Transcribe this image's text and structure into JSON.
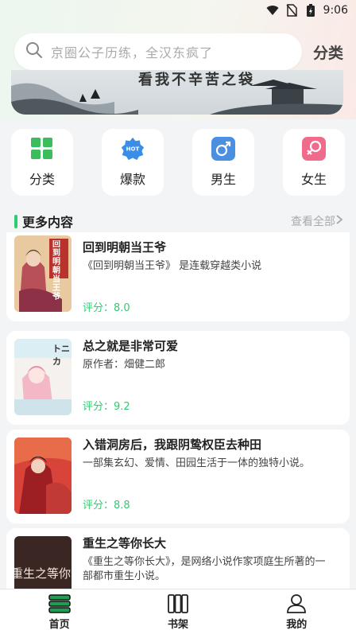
{
  "status": {
    "time": "9:06"
  },
  "search": {
    "placeholder": "京圈公子历练，全汉东疯了",
    "category_label": "分类"
  },
  "banner": {
    "title": "看我不辛苦之袋"
  },
  "categories": [
    {
      "label": "分类",
      "icon": "grid-icon"
    },
    {
      "label": "爆款",
      "icon": "hot-icon"
    },
    {
      "label": "男生",
      "icon": "male-icon"
    },
    {
      "label": "女生",
      "icon": "female-icon"
    }
  ],
  "section": {
    "title": "更多内容",
    "see_all": "查看全部"
  },
  "books": [
    {
      "title": "回到明朝当王爷",
      "desc": "《回到明朝当王爷》 是连载穿越类小说",
      "score": "评分：8.0"
    },
    {
      "title": "总之就是非常可爱",
      "desc": "原作者：畑健二郎",
      "score": "评分：9.2"
    },
    {
      "title": "入错洞房后，我跟阴鸷权臣去种田",
      "desc": "一部集玄幻、爱情、田园生活于一体的独特小说。",
      "score": "评分：8.8"
    },
    {
      "title": "重生之等你长大",
      "desc": "《重生之等你长大》，是网络小说作家项庭生所著的一部都市重生小说。",
      "score": ""
    }
  ],
  "covers": {
    "book1": "回到明朝当王爷",
    "book2": "トニカ",
    "book4": "重生之等你长大"
  },
  "tabs": [
    {
      "label": "首页",
      "icon": "home-books-icon"
    },
    {
      "label": "书架",
      "icon": "bookshelf-icon"
    },
    {
      "label": "我的",
      "icon": "user-icon"
    }
  ],
  "colors": {
    "accent": "#2ecc71",
    "hot": "#3a8ee6",
    "male": "#4a8fe0",
    "female": "#f06a8c"
  }
}
